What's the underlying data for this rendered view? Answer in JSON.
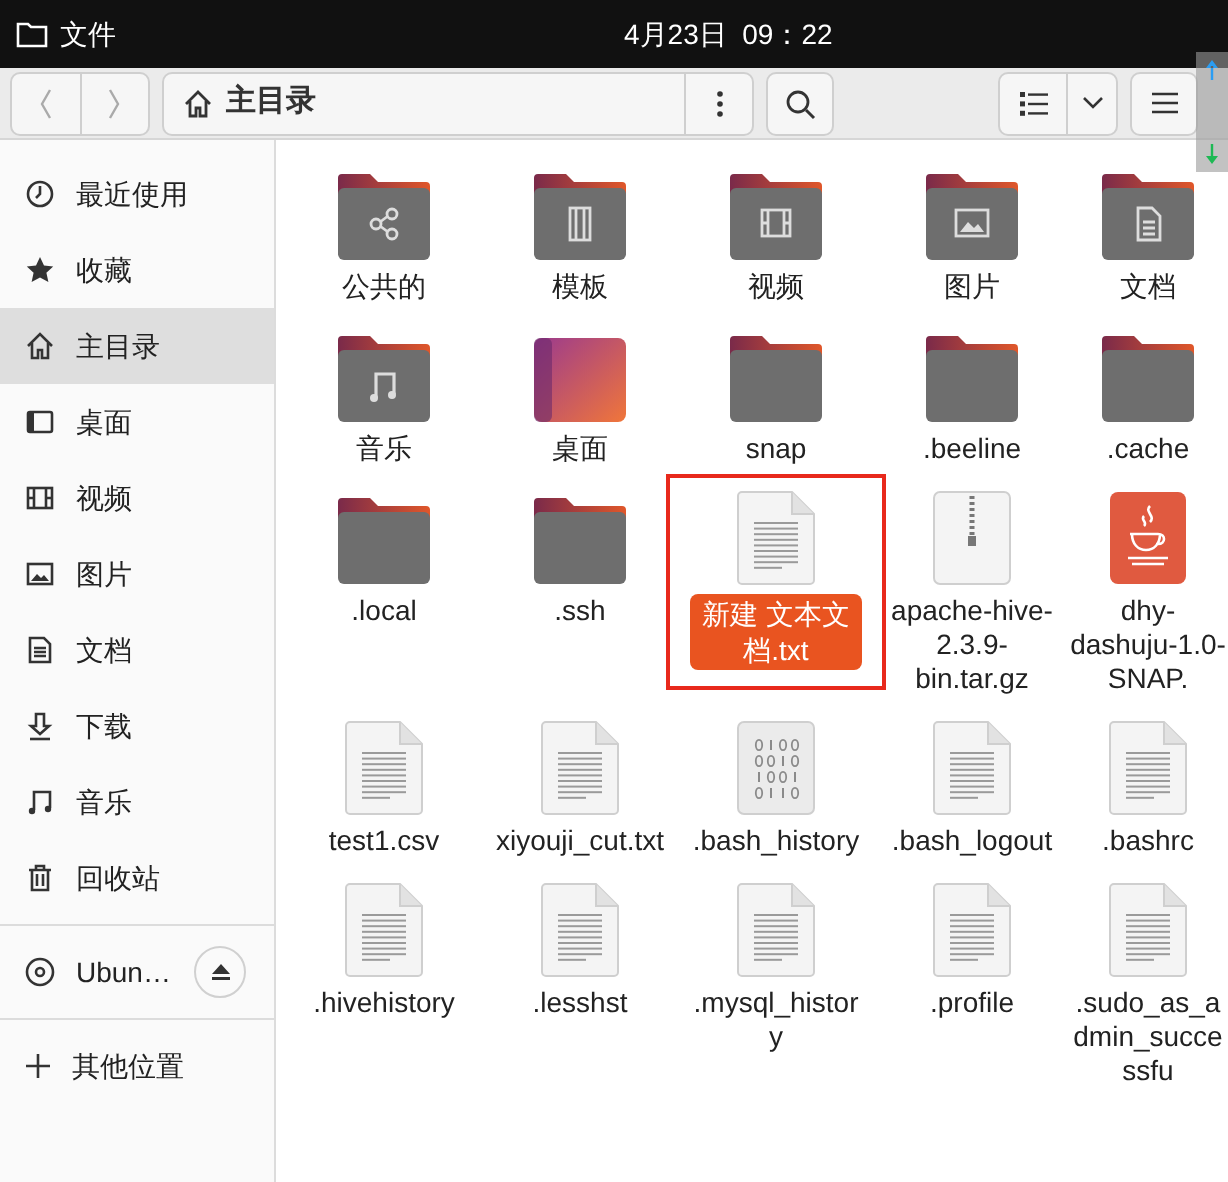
{
  "top_bar": {
    "app_name": "文件",
    "clock": "4月23日  09：22"
  },
  "toolbar": {
    "location": "主目录"
  },
  "sidebar": {
    "items": [
      {
        "kind": "recent",
        "label": "最近使用",
        "selected": false
      },
      {
        "kind": "starred",
        "label": "收藏",
        "selected": false
      },
      {
        "kind": "home",
        "label": "主目录",
        "selected": true
      },
      {
        "kind": "desktop",
        "label": "桌面",
        "selected": false
      },
      {
        "kind": "video",
        "label": "视频",
        "selected": false
      },
      {
        "kind": "picture",
        "label": "图片",
        "selected": false
      },
      {
        "kind": "document",
        "label": "文档",
        "selected": false
      },
      {
        "kind": "download",
        "label": "下载",
        "selected": false
      },
      {
        "kind": "music",
        "label": "音乐",
        "selected": false
      },
      {
        "kind": "trash",
        "label": "回收站",
        "selected": false
      }
    ],
    "device": {
      "label": "Ubun…"
    },
    "other": {
      "label": "其他位置"
    }
  },
  "files": [
    {
      "kind": "folder-share",
      "label": "公共的",
      "selected": false
    },
    {
      "kind": "folder-template",
      "label": "模板",
      "selected": false
    },
    {
      "kind": "folder-video",
      "label": "视频",
      "selected": false
    },
    {
      "kind": "folder-picture",
      "label": "图片",
      "selected": false
    },
    {
      "kind": "folder-document",
      "label": "文档",
      "selected": false
    },
    {
      "kind": "folder-music",
      "label": "音乐",
      "selected": false
    },
    {
      "kind": "desktop",
      "label": "桌面",
      "selected": false
    },
    {
      "kind": "folder",
      "label": "snap",
      "selected": false
    },
    {
      "kind": "folder",
      "label": ".beeline",
      "selected": false
    },
    {
      "kind": "folder",
      "label": ".cache",
      "selected": false
    },
    {
      "kind": "folder",
      "label": ".local",
      "selected": false
    },
    {
      "kind": "folder",
      "label": ".ssh",
      "selected": false
    },
    {
      "kind": "text",
      "label": "新建 文本文档.txt",
      "selected": true,
      "annotated": true
    },
    {
      "kind": "archive",
      "label": "apache-hive-2.3.9-bin.tar.gz",
      "selected": false
    },
    {
      "kind": "java",
      "label": "dhy-dashuju-1.0-SNAP.",
      "selected": false
    },
    {
      "kind": "text",
      "label": "test1.csv",
      "selected": false
    },
    {
      "kind": "text",
      "label": "xiyouji_cut.txt",
      "selected": false
    },
    {
      "kind": "binary",
      "label": ".bash_history",
      "selected": false
    },
    {
      "kind": "text",
      "label": ".bash_logout",
      "selected": false
    },
    {
      "kind": "text",
      "label": ".bashrc",
      "selected": false
    },
    {
      "kind": "text",
      "label": ".hivehistory",
      "selected": false
    },
    {
      "kind": "text",
      "label": ".lesshst",
      "selected": false
    },
    {
      "kind": "text",
      "label": ".mysql_history",
      "selected": false
    },
    {
      "kind": "text",
      "label": ".profile",
      "selected": false
    },
    {
      "kind": "text",
      "label": ".sudo_as_admin_successfu",
      "selected": false
    }
  ]
}
